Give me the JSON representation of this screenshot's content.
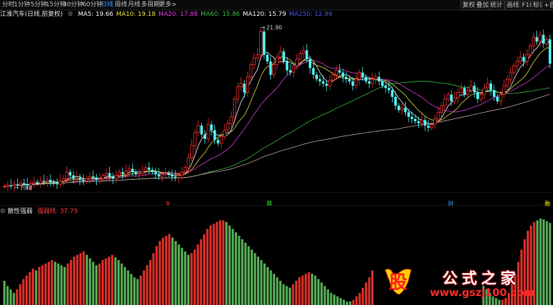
{
  "periods": [
    "分时",
    "1分钟",
    "5分钟",
    "15分钟",
    "30分钟",
    "60分钟",
    "日线",
    "周线",
    "月线",
    "多周期",
    "更多>"
  ],
  "active_period": "日线",
  "right_buttons": [
    "复权",
    "叠加",
    "统计",
    "画线",
    "F10",
    "标记",
    "+自"
  ],
  "stock_title": "江淮汽车(日线,前复权)",
  "ma": [
    {
      "label": "MA5: 19.66",
      "color": "#ffffff"
    },
    {
      "label": "MA10: 19.18",
      "color": "#e8e84a"
    },
    {
      "label": "MA20: 17.88",
      "color": "#e040e0"
    },
    {
      "label": "MA60: 15.86",
      "color": "#40c040"
    },
    {
      "label": "MA120: 15.79",
      "color": "#ffffff"
    },
    {
      "label": "MA250: 12.99",
      "color": "#5050ff"
    }
  ],
  "annotations": {
    "high": "21.90",
    "low": "7.88"
  },
  "markers": [
    {
      "label": "B",
      "color": "#ff3030"
    },
    {
      "label": "跌",
      "color": "#40ff40"
    },
    {
      "label": "财",
      "color": "#3aa0ff"
    },
    {
      "label": "融",
      "color": "#ffff00"
    }
  ],
  "sub_title": "散性强弱",
  "sub_value": "强弱线: 37.75",
  "colors": {
    "up": "#ff3030",
    "down": "#54ffff",
    "bar_up": "#e0302a",
    "bar_down": "#58b058"
  },
  "watermark": {
    "char": "股",
    "text": "公式之家",
    "url": "www.gszj100.com"
  },
  "chart_data": {
    "type": "candlestick",
    "prices": [
      7.9,
      8.0,
      7.95,
      8.1,
      8.05,
      8.2,
      8.1,
      8.0,
      8.15,
      8.3,
      8.2,
      8.4,
      8.35,
      8.5,
      8.3,
      8.2,
      8.1,
      8.4,
      8.6,
      9.2,
      8.9,
      8.6,
      8.7,
      8.5,
      8.4,
      8.6,
      8.8,
      8.7,
      8.5,
      8.6,
      8.9,
      9.1,
      8.8,
      8.6,
      8.9,
      9.2,
      9.0,
      9.3,
      9.5,
      9.2,
      9.0,
      9.1,
      9.3,
      9.6,
      9.4,
      9.2,
      9.0,
      8.8,
      9.0,
      9.1,
      9.0,
      8.8,
      8.7,
      8.9,
      9.2,
      9.6,
      10.5,
      11.6,
      12.8,
      13.4,
      12.6,
      12.2,
      13.5,
      13.0,
      12.1,
      11.8,
      12.4,
      13.0,
      13.6,
      14.2,
      15.8,
      16.9,
      17.2,
      16.4,
      17.8,
      18.9,
      19.5,
      19.8,
      21.9,
      19.8,
      19.2,
      18.0,
      18.9,
      19.6,
      20.1,
      19.2,
      18.4,
      18.2,
      18.8,
      19.4,
      19.9,
      20.2,
      19.4,
      18.6,
      18.0,
      17.6,
      17.4,
      17.2,
      17.0,
      17.5,
      18.0,
      18.4,
      18.2,
      17.8,
      17.6,
      17.4,
      17.0,
      17.6,
      18.2,
      17.8,
      17.4,
      17.2,
      17.6,
      17.8,
      17.4,
      17.0,
      16.8,
      16.6,
      16.0,
      15.2,
      14.8,
      15.0,
      14.6,
      14.2,
      14.0,
      13.8,
      13.6,
      13.9,
      13.4,
      13.2,
      13.5,
      14.0,
      14.6,
      15.2,
      15.8,
      16.2,
      15.6,
      15.9,
      16.4,
      16.8,
      16.2,
      16.6,
      17.0,
      16.4,
      15.8,
      16.2,
      16.8,
      17.2,
      16.6,
      16.0,
      15.6,
      16.2,
      17.0,
      17.6,
      18.2,
      18.8,
      19.2,
      19.6,
      19.2,
      19.8,
      20.6,
      21.4,
      21.0,
      21.6,
      20.8,
      21.2,
      19.0
    ],
    "ylim": [
      7.5,
      22.5
    ]
  },
  "sub_chart": {
    "type": "bar",
    "values": [
      28,
      22,
      18,
      14,
      18,
      24,
      30,
      34,
      38,
      42,
      40,
      44,
      46,
      48,
      50,
      52,
      50,
      48,
      46,
      44,
      48,
      52,
      56,
      58,
      60,
      62,
      58,
      54,
      50,
      46,
      48,
      52,
      54,
      56,
      58,
      55,
      52,
      48,
      44,
      40,
      36,
      32,
      30,
      34,
      40,
      46,
      52,
      60,
      68,
      74,
      78,
      80,
      82,
      78,
      74,
      70,
      66,
      62,
      58,
      60,
      64,
      70,
      76,
      82,
      88,
      92,
      94,
      96,
      98,
      98,
      96,
      92,
      88,
      84,
      80,
      76,
      72,
      68,
      64,
      60,
      56,
      52,
      48,
      44,
      40,
      36,
      32,
      28,
      24,
      22,
      20,
      24,
      28,
      32,
      34,
      36,
      38,
      36,
      34,
      30,
      26,
      22,
      18,
      14,
      12,
      10,
      8,
      6,
      4,
      4,
      6,
      10,
      14,
      20,
      26,
      32,
      40,
      46,
      52,
      56,
      60,
      62,
      60,
      56,
      50,
      44,
      40,
      36,
      34,
      36,
      40,
      44,
      48,
      52,
      56,
      60,
      62,
      64,
      62,
      60,
      58,
      56,
      54,
      52,
      50,
      46,
      42,
      38,
      34,
      30,
      26,
      22,
      18,
      14,
      10,
      8,
      6,
      6,
      8,
      14,
      24,
      36,
      50,
      64,
      76,
      86,
      92,
      96,
      98,
      100,
      99,
      97,
      95
    ],
    "up_flags": [
      0,
      0,
      0,
      0,
      1,
      1,
      1,
      1,
      1,
      1,
      0,
      1,
      1,
      1,
      1,
      1,
      0,
      0,
      0,
      0,
      1,
      1,
      1,
      1,
      1,
      1,
      0,
      0,
      0,
      0,
      1,
      1,
      1,
      1,
      1,
      0,
      0,
      0,
      0,
      0,
      0,
      0,
      0,
      1,
      1,
      1,
      1,
      1,
      1,
      1,
      1,
      1,
      1,
      0,
      0,
      0,
      0,
      0,
      0,
      1,
      1,
      1,
      1,
      1,
      1,
      1,
      1,
      1,
      1,
      1,
      0,
      0,
      0,
      0,
      0,
      0,
      0,
      0,
      0,
      0,
      0,
      0,
      0,
      0,
      0,
      0,
      0,
      0,
      0,
      0,
      0,
      1,
      1,
      1,
      1,
      1,
      1,
      0,
      0,
      0,
      0,
      0,
      0,
      0,
      0,
      0,
      0,
      0,
      0,
      0,
      1,
      1,
      1,
      1,
      1,
      1,
      1,
      1,
      1,
      1,
      1,
      1,
      0,
      0,
      0,
      0,
      0,
      0,
      0,
      1,
      1,
      1,
      1,
      1,
      1,
      1,
      1,
      1,
      0,
      0,
      0,
      0,
      0,
      0,
      0,
      0,
      0,
      0,
      0,
      0,
      0,
      0,
      0,
      0,
      0,
      0,
      0,
      1,
      1,
      1,
      1,
      1,
      1,
      1,
      1,
      1,
      1,
      1,
      0,
      0,
      0,
      0,
      0
    ]
  }
}
